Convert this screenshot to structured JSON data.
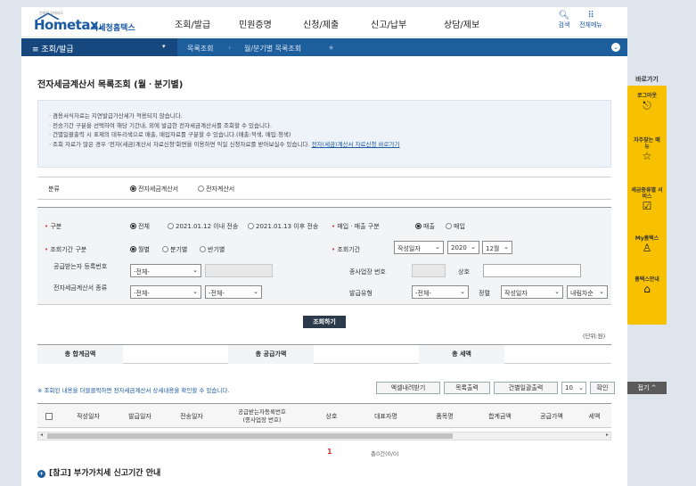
{
  "header": {
    "logo_sub": "언제든 집에서도",
    "logo_main": "Hometax.",
    "logo_ko": "국세청홈택스",
    "menu": [
      "조회/발급",
      "민원증명",
      "신청/제출",
      "신고/납부",
      "상담/제보"
    ],
    "search_label": "검색",
    "allmenu_label": "전체메뉴"
  },
  "nav": {
    "menu_label": "≡ 조회/발급",
    "crumbs": [
      "목록조회",
      "월/분기별 목록조회"
    ]
  },
  "page_title": "전자세금계산서 목록조회 (월ㆍ분기별)",
  "notice": {
    "lines": [
      "ㆍ겸용서식자료는 지연발급가산세가 적용되지 않습니다.",
      "ㆍ전송기간 구분을 선택하여 해당 기간내, 외에 발급한 전자세금계산서를 조회할 수 있습니다.",
      "ㆍ건별일괄출력 시 표제의 테두리색으로 매출, 매입자료를 구분할 수 있습니다.(매출:적색, 매입:청색)",
      "ㆍ조회 자료가 많은 경우 '전자(세금)계산서 자료신청'화면을 이용하면 익일 신청자료를 받아보실수 있습니다."
    ],
    "link": "전자(세금)계산서 자료신청 바로가기"
  },
  "type": {
    "label": "분류",
    "options": [
      "전자세금계산서",
      "전자계산서"
    ]
  },
  "filter": {
    "gubun_label": "구분",
    "gubun_options": [
      "전체",
      "2021.01.12 이내 전송",
      "2021.01.13 이후 전송"
    ],
    "trade_label": "매입ㆍ매출 구분",
    "trade_options": [
      "매출",
      "매입"
    ],
    "period_type_label": "조회기간 구분",
    "period_type_options": [
      "월별",
      "분기별",
      "반기별"
    ],
    "period_label": "조회기간",
    "period_date_type": "작성일자",
    "period_year": "2020",
    "period_month": "12월",
    "receiver_label": "공급받는자 등록번호",
    "receiver_select": "-전체-",
    "branch_label": "종사업장 번호",
    "trade_name_label": "상호",
    "doc_type_label": "전자세금계산서 종류",
    "doc_type_1": "-전체-",
    "doc_type_2": "-전체-",
    "issue_type_label": "발급유형",
    "issue_type": "-전체-",
    "sort_label": "정렬",
    "sort_field": "작성일자",
    "sort_order": "내림차순"
  },
  "search_button": "조회하기",
  "unit": "(단위:원)",
  "totals": {
    "sum_label": "총 합계금액",
    "supply_label": "총 공급가액",
    "tax_label": "총 세액"
  },
  "info_text": "※ 조회된 내용을 더블클릭하면 전자세금계산서 상세내용을 확인할 수 있습니다.",
  "buttons": {
    "excel": "엑셀내려받기",
    "print": "목록출력",
    "batch": "건별일괄출력",
    "page_size": "10",
    "confirm": "확인"
  },
  "grid": {
    "columns": [
      "작성일자",
      "발급일자",
      "전송일자",
      "공급받는자등록번호\n(종사업장 번호)",
      "상호",
      "대표자명",
      "품목명",
      "합계금액",
      "공급가액",
      "세액"
    ]
  },
  "pager": {
    "current": "1",
    "count_text": "총0건(0/0)"
  },
  "ref_title": "[참고] 부가가치세 신고기간 안내",
  "quick": {
    "title": "바로가기",
    "items": [
      {
        "label": "로그아웃",
        "icon": "logout-icon",
        "glyph": "⎋"
      },
      {
        "label": "자주찾는 메뉴",
        "icon": "star-icon",
        "glyph": "☆"
      },
      {
        "label": "세금종류별 서비스",
        "icon": "check-icon",
        "glyph": "☑"
      },
      {
        "label": "My홈택스",
        "icon": "user-icon",
        "glyph": "♙"
      },
      {
        "label": "홈택스안내",
        "icon": "home-icon",
        "glyph": "⌂"
      }
    ],
    "top": "접기 ^"
  }
}
